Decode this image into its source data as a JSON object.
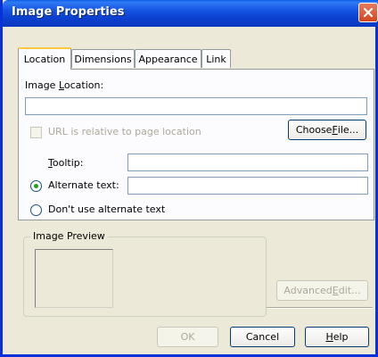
{
  "window": {
    "title": "Image Properties"
  },
  "tabs": [
    {
      "label": "Location"
    },
    {
      "label": "Dimensions"
    },
    {
      "label": "Appearance"
    },
    {
      "label": "Link"
    }
  ],
  "location": {
    "image_location_label_pre": "Image ",
    "image_location_label_ul": "L",
    "image_location_label_post": "ocation:",
    "image_location_value": "",
    "url_relative_label": "URL is relative to page location",
    "choose_file_pre": "Choose ",
    "choose_file_ul": "F",
    "choose_file_post": "ile...",
    "tooltip_ul": "T",
    "tooltip_post": "ooltip:",
    "tooltip_value": "",
    "alt_text_label": "Alternate text:",
    "alt_text_value": "",
    "no_alt_label": "Don't use alternate text"
  },
  "preview": {
    "group_label": "Image Preview",
    "advanced_edit_pre": "Advanced ",
    "advanced_edit_ul": "E",
    "advanced_edit_post": "dit..."
  },
  "buttons": {
    "ok": "OK",
    "cancel": "Cancel",
    "help_ul": "H",
    "help_post": "elp"
  }
}
